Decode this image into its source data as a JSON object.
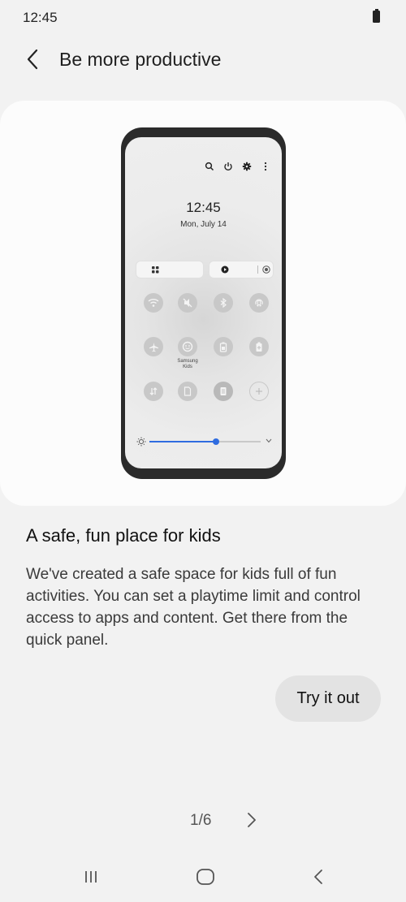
{
  "status_bar": {
    "time": "12:45"
  },
  "header": {
    "title": "Be more productive"
  },
  "illustration": {
    "time": "12:45",
    "date": "Mon, July 14",
    "tile_label": "Samsung Kids",
    "brightness_level": 0.6
  },
  "content": {
    "title": "A safe, fun place for kids",
    "description": "We've created a safe space for kids full of fun activities. You can set a playtime limit and control access to apps and content. Get there from the quick panel.",
    "button_label": "Try it out"
  },
  "pager": {
    "indicator": "1/6"
  },
  "colors": {
    "accent": "#2f6ce0",
    "background": "#f2f2f2",
    "card": "#fcfcfc",
    "button": "#e3e3e3"
  }
}
